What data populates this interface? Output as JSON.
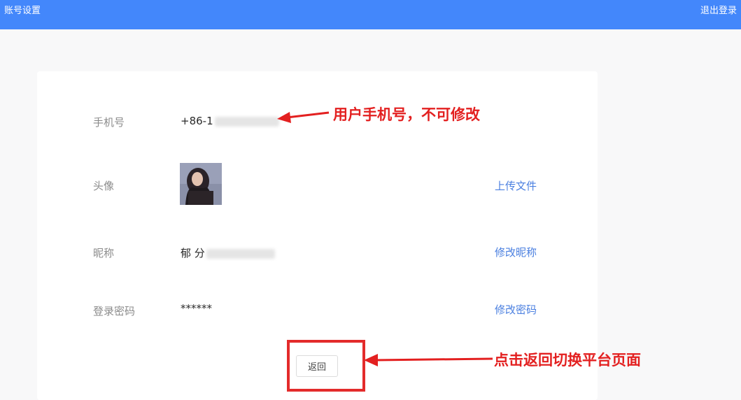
{
  "header": {
    "title": "账号设置",
    "logout_label": "退出登录"
  },
  "rows": {
    "phone": {
      "label": "手机号",
      "value": "+86-1"
    },
    "avatar": {
      "label": "头像",
      "action": "上传文件"
    },
    "nickname": {
      "label": "昵称",
      "value": "郁 分",
      "action": "修改昵称"
    },
    "password": {
      "label": "登录密码",
      "value": "******",
      "action": "修改密码"
    }
  },
  "buttons": {
    "back_label": "返回"
  },
  "annotations": {
    "phone_note": "用户手机号，不可修改",
    "back_note": "点击返回切换平台页面"
  },
  "colors": {
    "header_bg": "#4387fb",
    "link": "#4a7fe0",
    "annotation": "#e32020"
  }
}
